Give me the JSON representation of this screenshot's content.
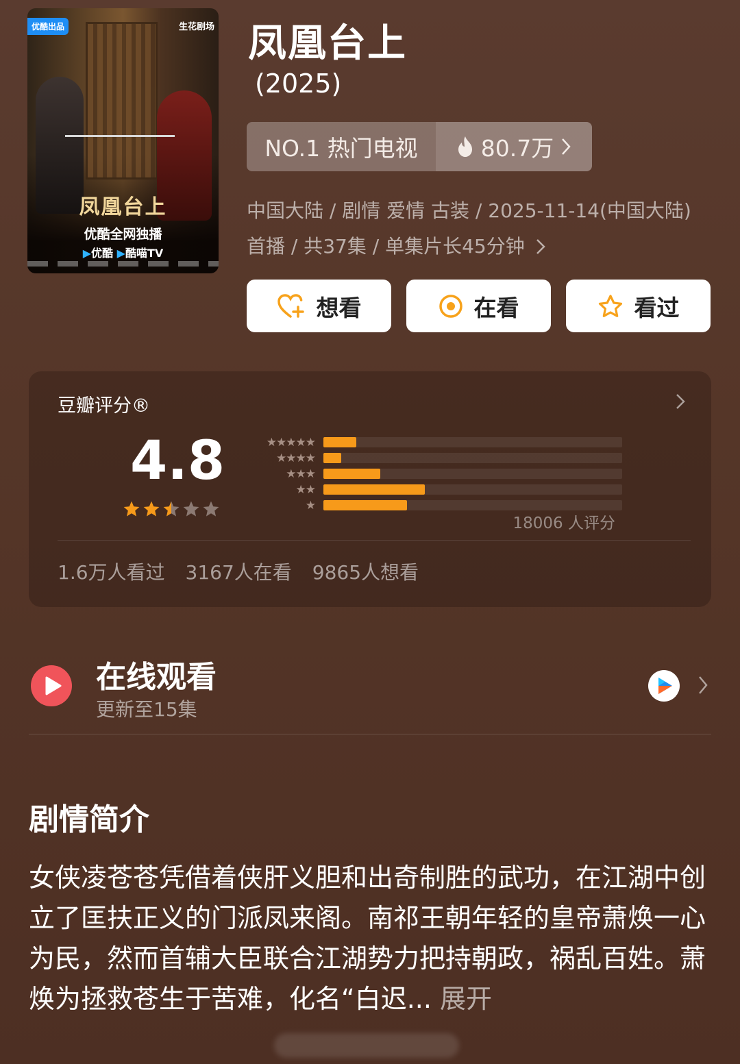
{
  "poster": {
    "badge_left": "优酷出品",
    "badge_right": "生花剧场",
    "title": "凤凰台上",
    "subtitle": "优酷全网独播",
    "platform_a": "优酷",
    "platform_b": "酷喵TV"
  },
  "show": {
    "title": "凤凰台上",
    "year": "(2025)",
    "rank_label": "NO.1 热门电视",
    "heat": "80.7万",
    "meta": "中国大陆 / 剧情 爱情 古装 / 2025-11-14(中国大陆) 首播 / 共37集 / 单集片长45分钟"
  },
  "actions": [
    {
      "label": "想看",
      "icon": "heart-plus-icon"
    },
    {
      "label": "在看",
      "icon": "target-icon"
    },
    {
      "label": "看过",
      "icon": "star-outline-icon"
    }
  ],
  "rating": {
    "title": "豆瓣评分®",
    "score": "4.8",
    "stars_value": 2.5,
    "count_text": "18006 人评分",
    "distribution": [
      {
        "stars": "★★★★★",
        "fraction": 0.11
      },
      {
        "stars": "★★★★",
        "fraction": 0.06
      },
      {
        "stars": "★★★",
        "fraction": 0.19
      },
      {
        "stars": "★★",
        "fraction": 0.34
      },
      {
        "stars": "★",
        "fraction": 0.28
      }
    ],
    "stats": [
      "1.6万人看过",
      "3167人在看",
      "9865人想看"
    ]
  },
  "watch": {
    "title": "在线观看",
    "subtitle": "更新至15集"
  },
  "synopsis": {
    "title": "剧情简介",
    "text": "女侠凌苍苍凭借着侠肝义胆和出奇制胜的武功，在江湖中创立了匡扶正义的门派凤来阁。南祁王朝年轻的皇帝萧焕一心为民，然而首辅大臣联合江湖势力把持朝政，祸乱百姓。萧焕为拯救苍生于苦难，化名“白迟...",
    "more": "展开"
  },
  "colors": {
    "accent": "#f79a1a",
    "play_red": "#f0545a",
    "bg": "#553628"
  }
}
